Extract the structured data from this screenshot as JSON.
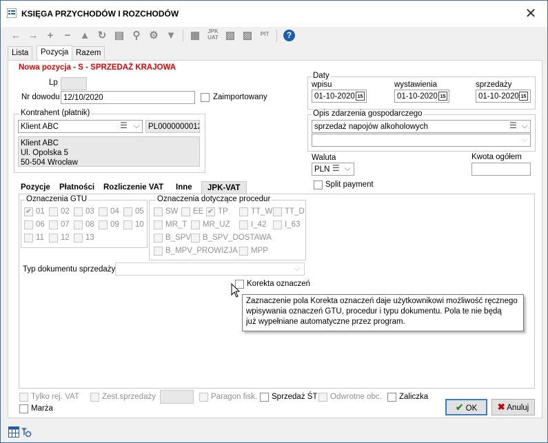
{
  "window": {
    "title": "KSIĘGA PRZYCHODÓW I ROZCHODÓW"
  },
  "toolbar": {
    "icons": [
      "arrow-left-icon",
      "arrow-right-icon",
      "plus-icon",
      "minus-icon",
      "warning-icon",
      "refresh-icon",
      "print-icon",
      "zoom-icon",
      "gear-icon",
      "filter-icon"
    ],
    "jpk_labels": [
      "JPK",
      "UAT"
    ],
    "pit_label": "PIT",
    "help_glyph": "?"
  },
  "top_tabs": [
    "Lista",
    "Pozycja",
    "Razem"
  ],
  "header": {
    "title": "Nowa pozycja - S - SPRZEDAŻ KRAJOWA"
  },
  "form": {
    "lp_label": "Lp",
    "nr_dowodu_label": "Nr dowodu",
    "nr_dowodu_value": "12/10/2020",
    "zaimportowany_label": "Zaimportowany",
    "kontrahent_group": "Kontrahent (płatnik)",
    "kontrahent_value": "Klient ABC",
    "nip_value": "PL0000000012",
    "address_lines": [
      "Klient ABC",
      "Ul. Opolska 5",
      "50-504 Wrocław"
    ],
    "daty_group": "Daty",
    "wpisu_label": "wpisu",
    "wpisu_value": "01-10-2020",
    "wystawienia_label": "wystawienia",
    "wystawienia_value": "01-10-2020",
    "sprzedazy_label": "sprzedaży",
    "sprzedazy_value": "01-10-2020",
    "opis_group": "Opis zdarzenia gospodarczego",
    "opis_value": "sprzedaż napojów alkoholowych",
    "waluta_label": "Waluta",
    "waluta_value": "PLN",
    "kwota_label": "Kwota ogółem",
    "split_label": "Split payment"
  },
  "sub_tabs": [
    "Pozycje",
    "Płatności",
    "Rozliczenie VAT",
    "Inne",
    "JPK-VAT"
  ],
  "gtu": {
    "group": "Oznaczenia GTU",
    "items": [
      "01",
      "02",
      "03",
      "04",
      "05",
      "06",
      "07",
      "08",
      "09",
      "10",
      "11",
      "12",
      "13"
    ]
  },
  "procedury": {
    "group": "Oznaczenia dotyczące procedur",
    "items": [
      "SW",
      "EE",
      "TP",
      "TT_WNT",
      "TT_D",
      "MR_T",
      "MR_UZ",
      "I_42",
      "I_63",
      "B_SPV",
      "B_SPV_DOSTAWA",
      "B_MPV_PROWIZJA",
      "MPP"
    ]
  },
  "typ_dokumentu_label": "Typ dokumentu sprzedaży",
  "korekta_label": "Korekta oznaczeń",
  "tooltip": {
    "lines": [
      "Zaznaczenie pola Korekta oznaczeń daje użytkownikowi możliwość ręcznego",
      "wpisywania oznaczeń GTU, procedur i typu dokumentu. Pola te nie będą",
      "już wypełniane automatyczne przez program."
    ]
  },
  "bottom": {
    "tylko_rej_vat": "Tylko rej. VAT",
    "zest_sprzedazy": "Zest.sprzedaży",
    "paragon_fisk": "Paragon fisk.",
    "sprzedaz_st": "Sprzedaż ŚT",
    "odwrotne_obc": "Odwrotne obc.",
    "zaliczka": "Zaliczka",
    "marza": "Marża",
    "ok": "OK",
    "anuluj": "Anuluj"
  },
  "colors": {
    "accent": "#1e5ea8",
    "red_title": "#e00000",
    "ok_check": "#2e8b2e",
    "cancel_x": "#c00000"
  }
}
